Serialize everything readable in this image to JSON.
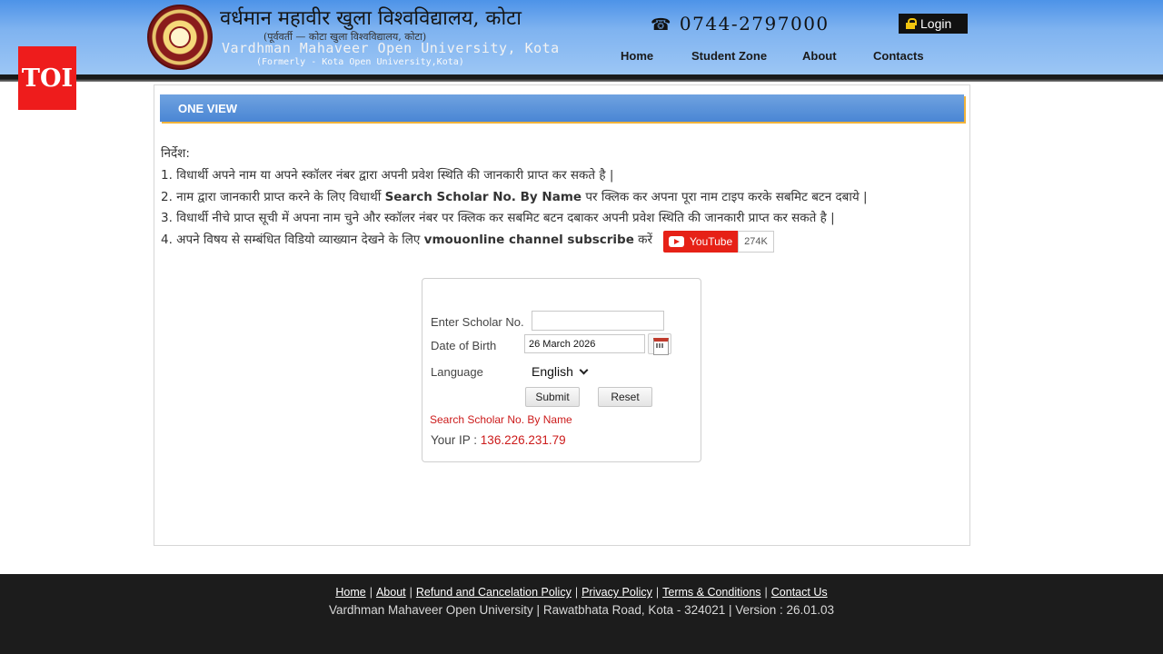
{
  "header": {
    "title_hindi": "वर्धमान महावीर खुला विश्वविद्यालय, कोटा",
    "subtitle_hindi": "(पूर्ववर्ती — कोटा खुला विश्वविद्यालय, कोटा)",
    "title_english": "Vardhman Mahaveer Open University, Kota",
    "formerly": "(Formerly - Kota Open University,Kota)",
    "phone": "0744-2797000",
    "login_label": "Login",
    "nav": [
      "Home",
      "Student Zone",
      "About",
      "Contacts"
    ]
  },
  "badge": {
    "label": "TOI",
    "color": "#ee1c1c"
  },
  "section": {
    "title": "ONE VIEW"
  },
  "instructions": {
    "heading": "निर्देश:",
    "line1": "1. विधार्थी अपने नाम या अपने स्कॉलर नंबर द्वारा अपनी प्रवेश स्थिति की जानकारी प्राप्त कर सकते है |",
    "line2_pre": "2. नाम द्वारा जानकारी प्राप्त करने के लिए विधार्थी ",
    "line2_bold": "Search Scholar No. By Name",
    "line2_post": " पर क्लिक कर अपना पूरा नाम टाइप करके सबमिट बटन दबाये |",
    "line3": "3. विधार्थी नीचे प्राप्त सूची में अपना नाम चुने और स्कॉलर नंबर पर क्लिक कर सबमिट बटन दबाकर अपनी प्रवेश स्थिति की जानकारी प्राप्त कर सकते है |",
    "line4_pre": "4. अपने विषय से सम्बंधित विडियो व्याख्यान देखने के लिए ",
    "line4_bold": "vmouonline channel subscribe",
    "line4_post": " करें"
  },
  "youtube": {
    "label": "YouTube",
    "count": "274K"
  },
  "form": {
    "scholar_label": "Enter Scholar No.",
    "scholar_value": "",
    "dob_label": "Date of Birth",
    "dob_value": "26 March 2026",
    "language_label": "Language",
    "language_value": "English",
    "submit_label": "Submit",
    "reset_label": "Reset",
    "search_link": "Search Scholar No. By Name",
    "ip_label": "Your IP : ",
    "ip_value": "136.226.231.79"
  },
  "footer": {
    "links": [
      "Home",
      "About",
      "Refund and Cancelation Policy",
      "Privacy Policy",
      "Terms & Conditions",
      "Contact Us"
    ],
    "info": "Vardhman Mahaveer Open University | Rawatbhata Road, Kota - 324021 | Version : 26.01.03"
  },
  "colors": {
    "header_blue": "#4d93e8",
    "section_blue": "#4a86d4",
    "accent_orange": "#f0b33b",
    "link_red": "#cc1b1b",
    "footer_bg": "#1c1c1c"
  }
}
